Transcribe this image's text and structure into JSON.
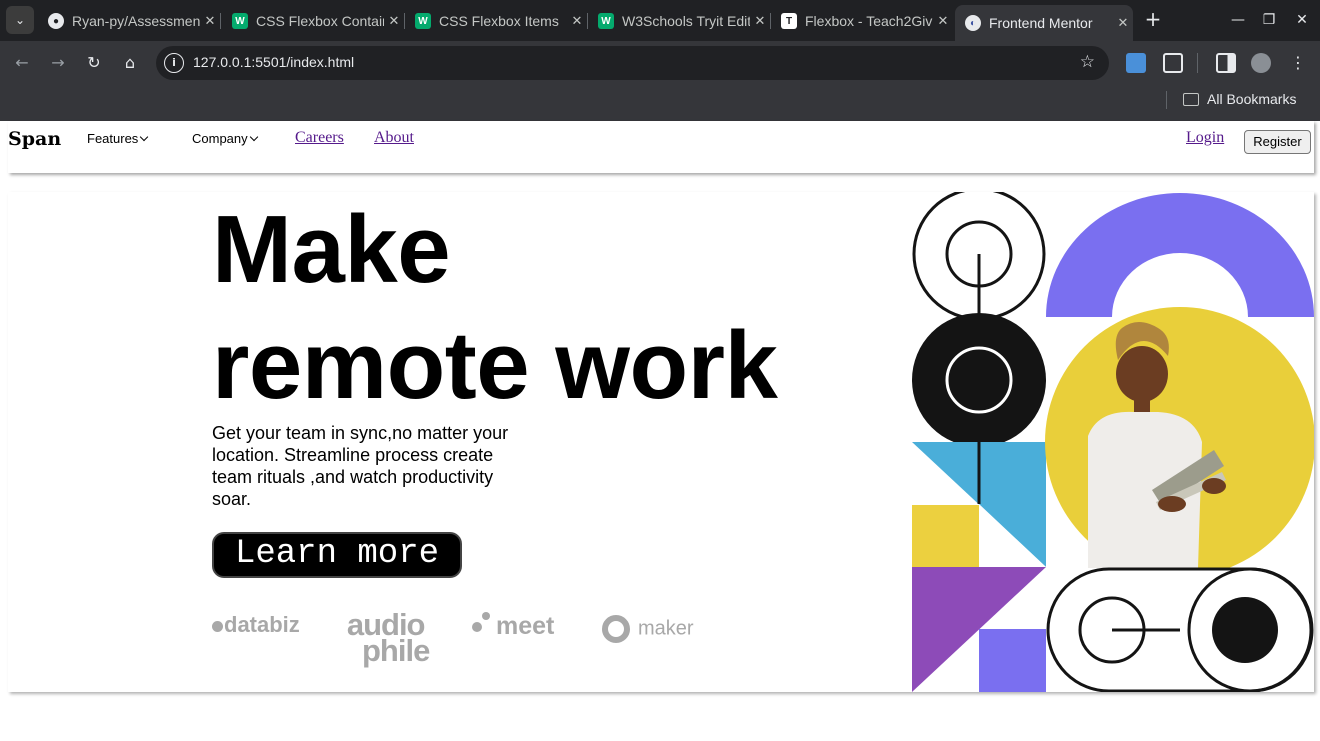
{
  "browser": {
    "tabs": [
      {
        "title": "Ryan-py/Assessment",
        "favicon": "github-icon"
      },
      {
        "title": "CSS Flexbox Container",
        "favicon": "w3schools-icon"
      },
      {
        "title": "CSS Flexbox Items",
        "favicon": "w3schools-icon"
      },
      {
        "title": "W3Schools Tryit Editor",
        "favicon": "w3schools-icon"
      },
      {
        "title": "Flexbox - Teach2Give",
        "favicon": "t-icon"
      },
      {
        "title": "Frontend Mentor",
        "favicon": "frontend-mentor-icon",
        "active": true
      }
    ],
    "url": "127.0.0.1:5501/index.html",
    "bookmarks_label": "All Bookmarks"
  },
  "site": {
    "brand": "Span",
    "nav": {
      "features": "Features",
      "company": "Company",
      "careers": "Careers",
      "about": "About",
      "login": "Login",
      "register": "Register"
    },
    "hero": {
      "title_line1": "Make",
      "title_line2": "remote work",
      "lead": "Get your team in sync,no matter your location. Streamline process create team rituals ,and watch productivity soar.",
      "cta": "Learn more"
    },
    "clients": {
      "databiz": "databiz",
      "audiophile_top": "audio",
      "audiophile_bottom": "phile",
      "meet": "meet",
      "maker": "maker"
    }
  },
  "colors": {
    "accent_purple": "#7a6ff0",
    "yellow": "#ecd03f",
    "cyan": "#4aaed9",
    "violet": "#8d4bb8",
    "dark": "#141414"
  }
}
